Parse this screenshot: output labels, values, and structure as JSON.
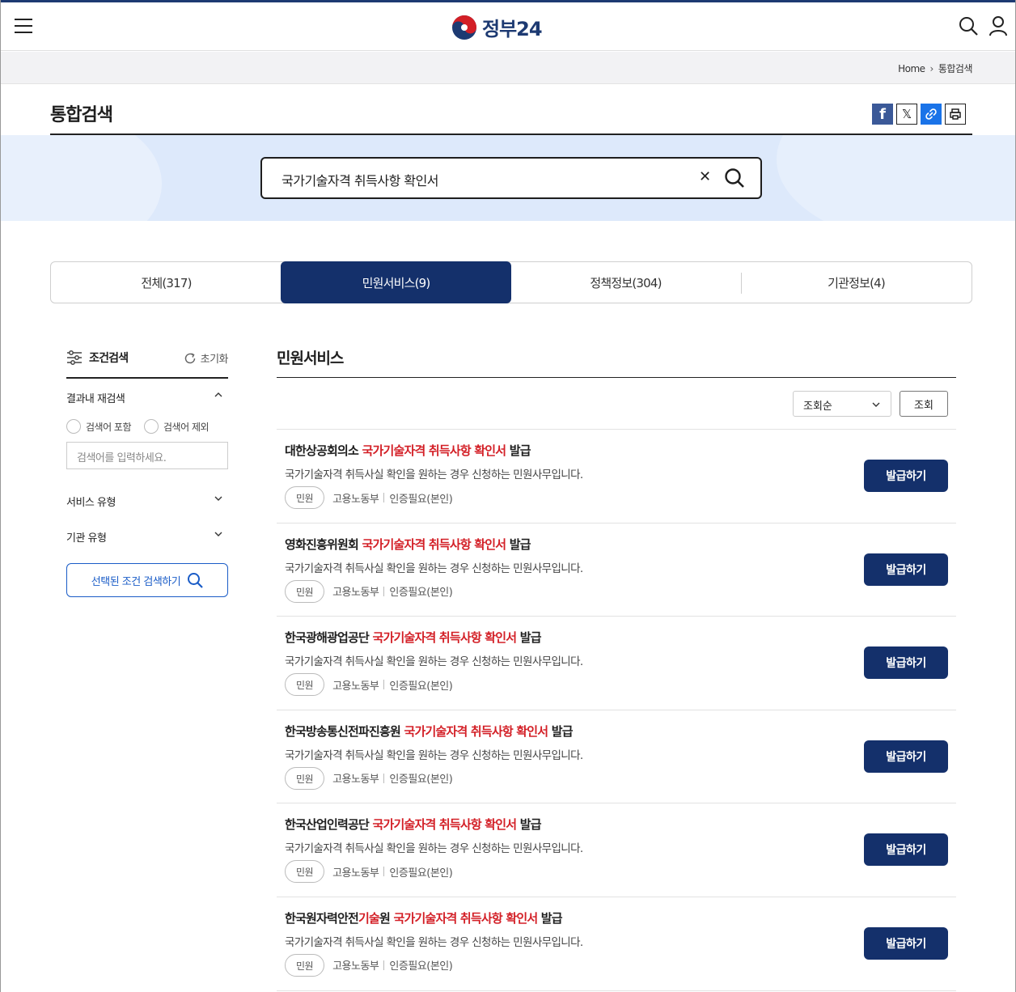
{
  "header": {
    "logo_text": "정부24",
    "menu_icon": "hamburger-menu-icon",
    "search_icon": "search-icon",
    "user_icon": "user-icon"
  },
  "breadcrumb": {
    "home": "Home",
    "current": "통합검색"
  },
  "page": {
    "title": "통합검색"
  },
  "share": {
    "facebook": "f",
    "x": "𝕏",
    "link": "🔗",
    "print": "🖶"
  },
  "search": {
    "value": "국가기술자격 취득사항 확인서",
    "clear": "✕"
  },
  "tabs": [
    {
      "label": "전체(317)",
      "active": false
    },
    {
      "label": "민원서비스(9)",
      "active": true
    },
    {
      "label": "정책정보(304)",
      "active": false
    },
    {
      "label": "기관정보(4)",
      "active": false
    }
  ],
  "sidebar": {
    "title": "조건검색",
    "reset": "초기화",
    "research_label": "결과내 재검색",
    "radio_include": "검색어 포함",
    "radio_exclude": "검색어 제외",
    "input_placeholder": "검색어를 입력하세요.",
    "service_type": "서비스 유형",
    "org_type": "기관 유형",
    "cond_button": "선택된 조건 검색하기"
  },
  "main": {
    "title": "민원서비스",
    "sort_value": "조회순",
    "query_button": "조회"
  },
  "results": [
    {
      "prefix": "대한상공회의소 ",
      "prefix_hl": "",
      "prefix_rest": "",
      "highlight": "국가기술자격 취득사항 확인서",
      "suffix": " 발급",
      "desc": "국가기술자격 취득사실 확인을 원하는 경우 신청하는 민원사무입니다.",
      "tag": "민원",
      "dept": "고용노동부",
      "auth": "인증필요(본인)",
      "button": "발급하기"
    },
    {
      "prefix": "영화진흥위원회 ",
      "prefix_hl": "",
      "prefix_rest": "",
      "highlight": "국가기술자격 취득사항 확인서",
      "suffix": " 발급",
      "desc": "국가기술자격 취득사실 확인을 원하는 경우 신청하는 민원사무입니다.",
      "tag": "민원",
      "dept": "고용노동부",
      "auth": "인증필요(본인)",
      "button": "발급하기"
    },
    {
      "prefix": "한국광해광업공단 ",
      "prefix_hl": "",
      "prefix_rest": "",
      "highlight": "국가기술자격 취득사항 확인서",
      "suffix": " 발급",
      "desc": "국가기술자격 취득사실 확인을 원하는 경우 신청하는 민원사무입니다.",
      "tag": "민원",
      "dept": "고용노동부",
      "auth": "인증필요(본인)",
      "button": "발급하기"
    },
    {
      "prefix": "한국방송통신전파진흥원 ",
      "prefix_hl": "",
      "prefix_rest": "",
      "highlight": "국가기술자격 취득사항 확인서",
      "suffix": " 발급",
      "desc": "국가기술자격 취득사실 확인을 원하는 경우 신청하는 민원사무입니다.",
      "tag": "민원",
      "dept": "고용노동부",
      "auth": "인증필요(본인)",
      "button": "발급하기"
    },
    {
      "prefix": "한국산업인력공단 ",
      "prefix_hl": "",
      "prefix_rest": "",
      "highlight": "국가기술자격 취득사항 확인서",
      "suffix": " 발급",
      "desc": "국가기술자격 취득사실 확인을 원하는 경우 신청하는 민원사무입니다.",
      "tag": "민원",
      "dept": "고용노동부",
      "auth": "인증필요(본인)",
      "button": "발급하기"
    },
    {
      "prefix": "한국원자력안전",
      "prefix_hl": "기술",
      "prefix_rest": "원 ",
      "highlight": "국가기술자격 취득사항 확인서",
      "suffix": " 발급",
      "desc": "국가기술자격 취득사실 확인을 원하는 경우 신청하는 민원사무입니다.",
      "tag": "민원",
      "dept": "고용노동부",
      "auth": "인증필요(본인)",
      "button": "발급하기"
    }
  ]
}
